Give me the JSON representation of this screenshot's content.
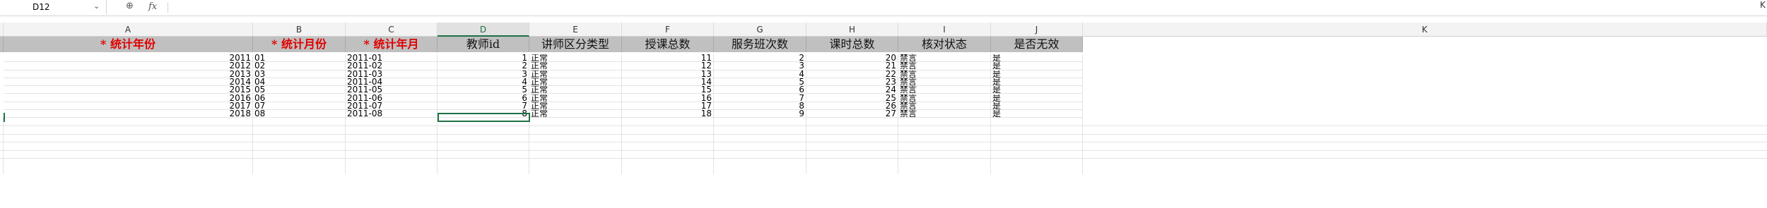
{
  "formula_bar": {
    "name_box": "D12",
    "fx_label": "fx",
    "formula": "",
    "right_edge": "K"
  },
  "columns": [
    "A",
    "B",
    "C",
    "D",
    "E",
    "F",
    "G",
    "H",
    "I",
    "J",
    "K"
  ],
  "selected_column": "D",
  "header_row": [
    {
      "text": "* 统计年份",
      "style": "red"
    },
    {
      "text": "* 统计月份",
      "style": "red"
    },
    {
      "text": "* 统计年月",
      "style": "red"
    },
    {
      "text": "教师id",
      "style": "normal"
    },
    {
      "text": "讲师区分类型",
      "style": "normal"
    },
    {
      "text": "授课总数",
      "style": "normal"
    },
    {
      "text": "服务班次数",
      "style": "normal"
    },
    {
      "text": "课时总数",
      "style": "normal"
    },
    {
      "text": "核对状态",
      "style": "normal"
    },
    {
      "text": "是否无效",
      "style": "normal"
    }
  ],
  "rows": [
    [
      "2011",
      "01",
      "2011-01",
      "1",
      "正常",
      "11",
      "2",
      "20",
      "禁言",
      "是"
    ],
    [
      "2012",
      "02",
      "2011-02",
      "2",
      "正常",
      "12",
      "3",
      "21",
      "禁言",
      "是"
    ],
    [
      "2013",
      "03",
      "2011-03",
      "3",
      "正常",
      "13",
      "4",
      "22",
      "禁言",
      "是"
    ],
    [
      "2014",
      "04",
      "2011-04",
      "4",
      "正常",
      "14",
      "5",
      "23",
      "禁言",
      "是"
    ],
    [
      "2015",
      "05",
      "2011-05",
      "5",
      "正常",
      "15",
      "6",
      "24",
      "禁言",
      "是"
    ],
    [
      "2016",
      "06",
      "2011-06",
      "6",
      "正常",
      "16",
      "7",
      "25",
      "禁言",
      "是"
    ],
    [
      "2017",
      "07",
      "2011-07",
      "7",
      "正常",
      "17",
      "8",
      "26",
      "禁言",
      "是"
    ],
    [
      "2018",
      "08",
      "2011-08",
      "8",
      "正常",
      "18",
      "9",
      "27",
      "禁言",
      "是"
    ]
  ],
  "colors": {
    "accent": "#1e7145",
    "header_bg": "#c0c0c0",
    "required_red": "#e00000"
  }
}
